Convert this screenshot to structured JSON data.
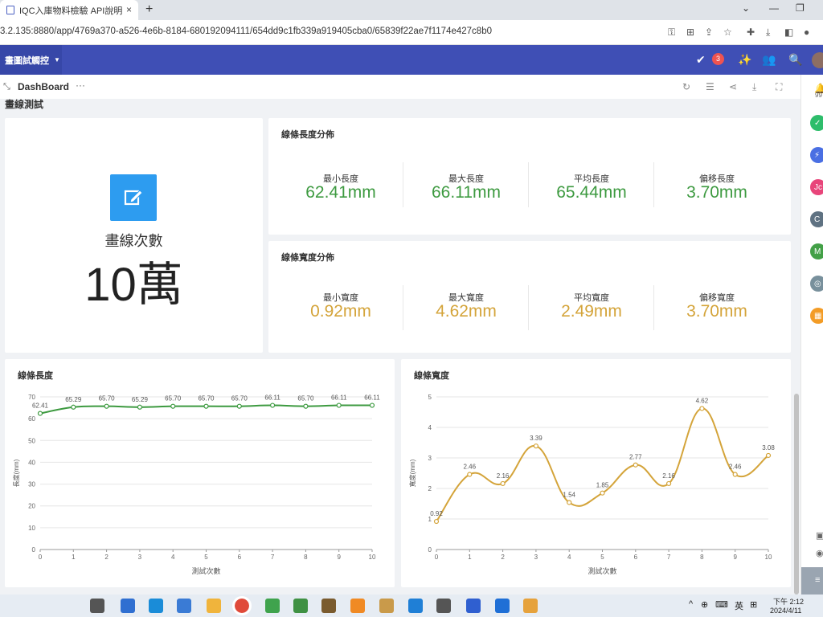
{
  "browser": {
    "tab_title": "IQC入庫物料檢驗 API說明",
    "tab_close": "×",
    "new_tab": "+",
    "url": "3.2.135:8880/app/4769a370-a526-4e6b-8184-680192094111/654dd9c1fb339a919405cba0/65839f22ae7f1174e427c8b0"
  },
  "app": {
    "title": "畫圖試觸控",
    "badge_count": "3"
  },
  "dashboard": {
    "title": "DashBoard",
    "more": "···",
    "section_label": "畫線測試"
  },
  "draw_count": {
    "label": "畫線次數",
    "value": "10萬"
  },
  "length_dist": {
    "title": "線條長度分佈",
    "color": "#3d9a40",
    "stats": [
      {
        "label": "最小長度",
        "value": "62.41mm"
      },
      {
        "label": "最大長度",
        "value": "66.11mm"
      },
      {
        "label": "平均長度",
        "value": "65.44mm"
      },
      {
        "label": "偏移長度",
        "value": "3.70mm"
      }
    ]
  },
  "width_dist": {
    "title": "線條寬度分佈",
    "color": "#d4a43a",
    "stats": [
      {
        "label": "最小寬度",
        "value": "0.92mm"
      },
      {
        "label": "最大寬度",
        "value": "4.62mm"
      },
      {
        "label": "平均寬度",
        "value": "2.49mm"
      },
      {
        "label": "偏移寬度",
        "value": "3.70mm"
      }
    ]
  },
  "chart_data": [
    {
      "type": "line",
      "title": "線條長度",
      "xlabel": "測試次數",
      "ylabel": "長度(mm)",
      "x": [
        0,
        1,
        2,
        3,
        4,
        5,
        6,
        7,
        8,
        9,
        10
      ],
      "series": [
        {
          "values": [
            62.41,
            65.29,
            65.7,
            65.29,
            65.7,
            65.7,
            65.7,
            66.11,
            65.7,
            66.11,
            66.11
          ]
        }
      ],
      "labels": [
        "62.41",
        "65.29",
        "65.70",
        "65.29",
        "65.70",
        "65.70",
        "65.70",
        "66.11",
        "65.70",
        "66.11",
        "66.11"
      ],
      "ylim": [
        0,
        70
      ],
      "yticks": [
        0,
        10,
        20,
        30,
        40,
        50,
        60,
        70
      ],
      "color": "#3d9a40",
      "smooth": true,
      "grid": true
    },
    {
      "type": "line",
      "title": "線條寬度",
      "xlabel": "測試次數",
      "ylabel": "寬度(mm)",
      "x": [
        0,
        1,
        2,
        3,
        4,
        5,
        6,
        7,
        8,
        9,
        10
      ],
      "series": [
        {
          "values": [
            0.92,
            2.46,
            2.16,
            3.39,
            1.54,
            1.85,
            2.77,
            2.16,
            4.62,
            2.46,
            3.08
          ]
        }
      ],
      "labels": [
        "0.92",
        "2.46",
        "2.16",
        "3.39",
        "1.54",
        "1.85",
        "2.77",
        "2.16",
        "4.62",
        "2.46",
        "3.08"
      ],
      "ylim": [
        0,
        5
      ],
      "yticks": [
        0,
        1,
        2,
        3,
        4,
        5
      ],
      "color": "#d4a43a",
      "smooth": true,
      "grid": true
    }
  ],
  "taskbar": {
    "time": "下午 2:12",
    "date": "2024/4/11",
    "ime": "英"
  },
  "sidebar": {
    "top_text": "99",
    "items": [
      {
        "letter": "✓",
        "color": "#2ebd6b"
      },
      {
        "letter": "⚡",
        "color": "#4a6fe3"
      },
      {
        "letter": "Jc",
        "color": "#e8457a"
      },
      {
        "letter": "C",
        "color": "#5f7282"
      },
      {
        "letter": "M",
        "color": "#43a047"
      },
      {
        "letter": "◎",
        "color": "#78909c"
      },
      {
        "letter": "▦",
        "color": "#f39c26"
      }
    ]
  }
}
